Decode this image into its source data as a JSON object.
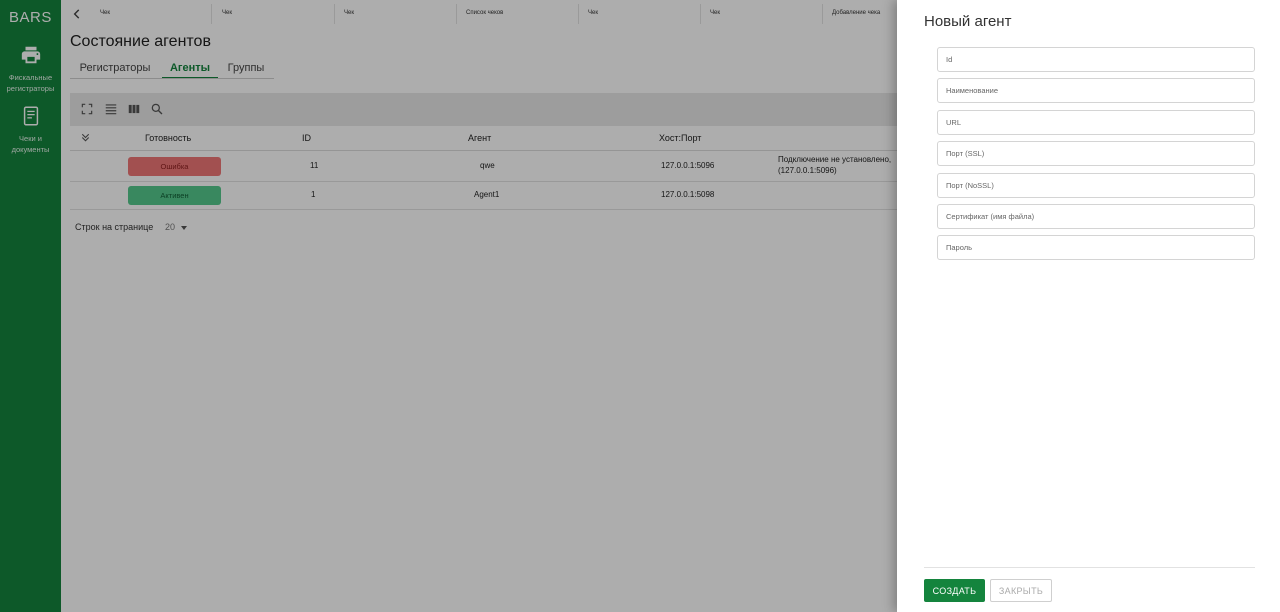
{
  "app": {
    "logo": "BARS"
  },
  "sidebar": {
    "items": [
      {
        "label": "Фискальные регистраторы",
        "icon": "printer-icon"
      },
      {
        "label": "Чеки и документы",
        "icon": "document-icon"
      }
    ]
  },
  "topbar": {
    "tabs": [
      "Чек",
      "Чек",
      "Чек",
      "Список чеков",
      "Чек",
      "Чек",
      "Добавление чека"
    ]
  },
  "page": {
    "title": "Состояние агентов",
    "tabs": [
      {
        "label": "Регистраторы",
        "active": false
      },
      {
        "label": "Агенты",
        "active": true
      },
      {
        "label": "Группы",
        "active": false
      }
    ]
  },
  "grid": {
    "columns": [
      "Готовность",
      "ID",
      "Агент",
      "Хост:Порт"
    ],
    "rows": [
      {
        "status": "Ошибка",
        "status_type": "error",
        "id": "11",
        "agent": "qwe",
        "host": "127.0.0.1:5096",
        "message_line1": "Подключение не установлено,",
        "message_line2": "(127.0.0.1:5096)"
      },
      {
        "status": "Активен",
        "status_type": "ok",
        "id": "1",
        "agent": "Agent1",
        "host": "127.0.0.1:5098",
        "message_line1": "",
        "message_line2": ""
      }
    ]
  },
  "pager": {
    "label": "Строк на странице",
    "value": "20"
  },
  "drawer": {
    "title": "Новый агент",
    "fields": [
      {
        "placeholder": "Id",
        "value": ""
      },
      {
        "placeholder": "Наименование",
        "value": ""
      },
      {
        "placeholder": "URL",
        "value": ""
      },
      {
        "placeholder": "Порт (SSL)",
        "value": ""
      },
      {
        "placeholder": "Порт (NoSSL)",
        "value": ""
      },
      {
        "placeholder": "Сертификат (имя файла)",
        "value": ""
      },
      {
        "placeholder": "Пароль",
        "value": ""
      }
    ],
    "create_label": "СОЗДАТЬ",
    "close_label": "ЗАКРЫТЬ"
  },
  "colors": {
    "brand": "#14843d",
    "error": "#ef7777",
    "ok": "#54c98d"
  }
}
